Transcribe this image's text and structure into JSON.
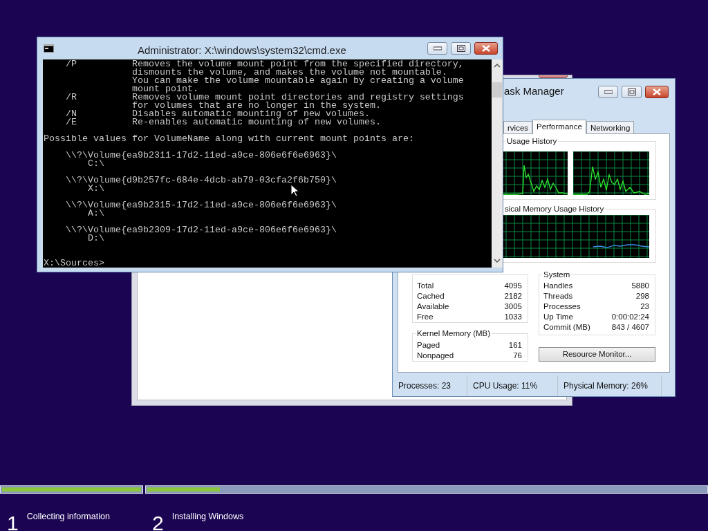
{
  "console": {
    "title": "Administrator: X:\\windows\\system32\\cmd.exe",
    "output": "    /P          Removes the volume mount point from the specified directory,\n                dismounts the volume, and makes the volume not mountable.\n                You can make the volume mountable again by creating a volume\n                mount point.\n    /R          Removes volume mount point directories and registry settings\n                for volumes that are no longer in the system.\n    /N          Disables automatic mounting of new volumes.\n    /E          Re-enables automatic mounting of new volumes.\n\nPossible values for VolumeName along with current mount points are:\n\n    \\\\?\\Volume{ea9b2311-17d2-11ed-a9ce-806e6f6e6963}\\\n        C:\\\n\n    \\\\?\\Volume{d9b257fc-684e-4dcb-ab79-03cfa2f6b750}\\\n        X:\\\n\n    \\\\?\\Volume{ea9b2315-17d2-11ed-a9ce-806e6f6e6963}\\\n        A:\\\n\n    \\\\?\\Volume{ea9b2309-17d2-11ed-a9ce-806e6f6e6963}\\\n        D:\\\n\n\nX:\\Sources>"
  },
  "task_manager": {
    "title": "ask Manager",
    "tabs": [
      {
        "label": "rvices",
        "selected": false
      },
      {
        "label": "Performance",
        "selected": true
      },
      {
        "label": "Networking",
        "selected": false
      }
    ],
    "cpu_history": {
      "title": "Usage History"
    },
    "memory_history": {
      "title": "sical Memory Usage History"
    },
    "physical_memory": {
      "rows": [
        {
          "label": "Total",
          "value": "4095"
        },
        {
          "label": "Cached",
          "value": "2182"
        },
        {
          "label": "Available",
          "value": "3005"
        },
        {
          "label": "Free",
          "value": "1033"
        }
      ]
    },
    "kernel_memory": {
      "title": "Kernel Memory (MB)",
      "rows": [
        {
          "label": "Paged",
          "value": "161"
        },
        {
          "label": "Nonpaged",
          "value": "76"
        }
      ]
    },
    "system": {
      "title": "System",
      "rows": [
        {
          "label": "Handles",
          "value": "5880"
        },
        {
          "label": "Threads",
          "value": "298"
        },
        {
          "label": "Processes",
          "value": "23"
        },
        {
          "label": "Up Time",
          "value": "0:00:02:24"
        },
        {
          "label": "Commit (MB)",
          "value": "843 / 4607"
        }
      ]
    },
    "resource_monitor_button": "Resource Monitor...",
    "status_bar": [
      "Processes: 23",
      "CPU Usage: 11%",
      "Physical Memory: 26%"
    ]
  },
  "setup_progress": {
    "steps": [
      {
        "number": "1",
        "label": "Collecting information",
        "level": 1
      },
      {
        "number": "2",
        "label": "Installing Windows",
        "level": 0.13
      }
    ]
  }
}
